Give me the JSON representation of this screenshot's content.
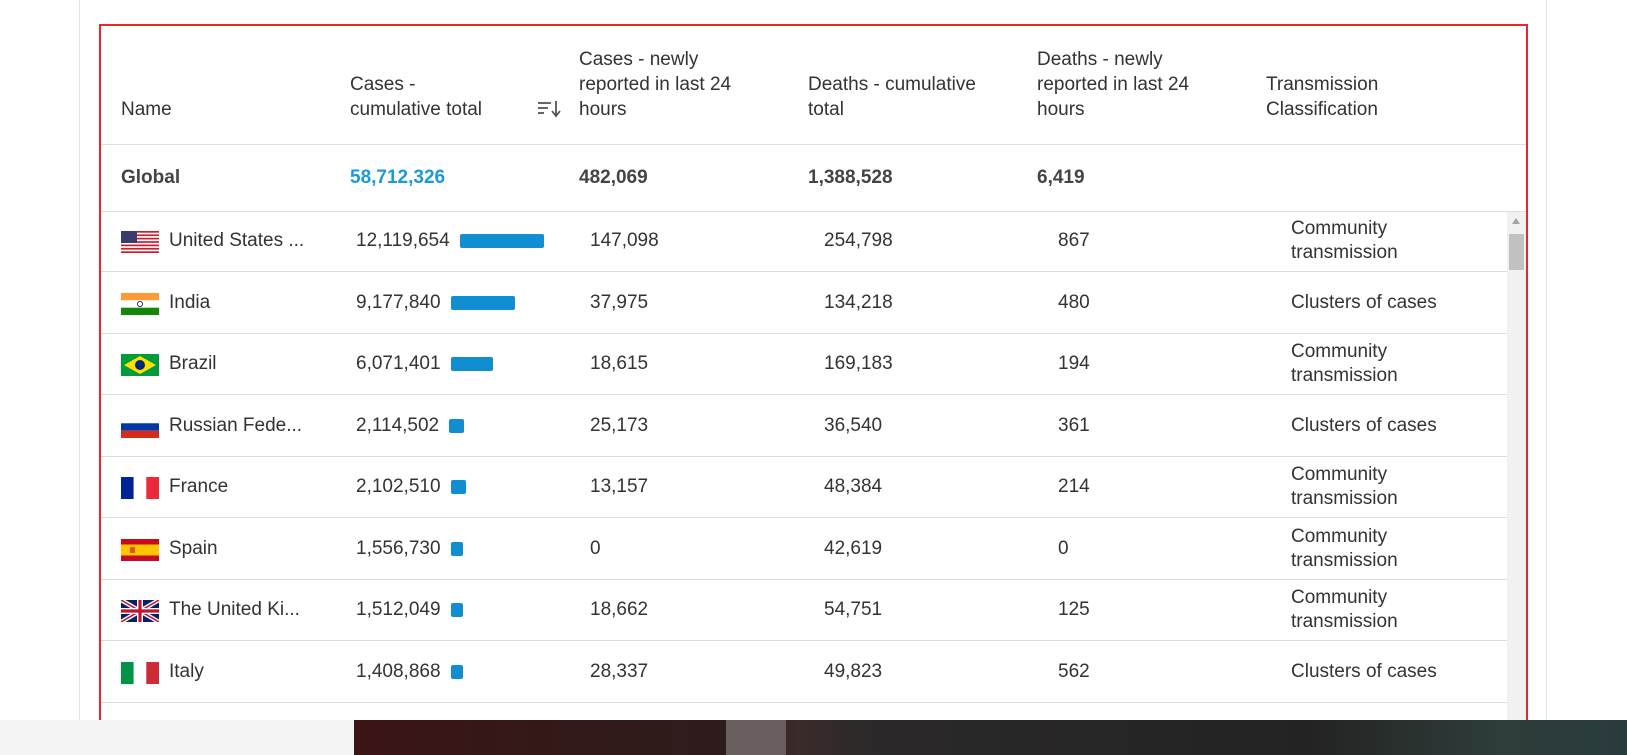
{
  "columns": {
    "name": "Name",
    "cases_total": [
      "Cases -",
      "cumulative total"
    ],
    "cases_new": [
      "Cases - newly",
      "reported in last 24",
      "hours"
    ],
    "deaths_total": [
      "Deaths - cumulative",
      "total"
    ],
    "deaths_new": [
      "Deaths - newly",
      "reported in last 24",
      "hours"
    ],
    "transmission": [
      "Transmission",
      "Classification"
    ]
  },
  "sort_icon": "sort-descending-icon",
  "global": {
    "name": "Global",
    "cases_total": "58,712,326",
    "cases_new": "482,069",
    "deaths_total": "1,388,528",
    "deaths_new": "6,419"
  },
  "rows": [
    {
      "flag": "us-flag-icon",
      "name": "United States ...",
      "cases_total": "12,119,654",
      "bar_fraction": 1.0,
      "cases_new": "147,098",
      "deaths_total": "254,798",
      "deaths_new": "867",
      "transmission": [
        "Community",
        "transmission"
      ]
    },
    {
      "flag": "india-flag-icon",
      "name": "India",
      "cases_total": "9,177,840",
      "bar_fraction": 0.757,
      "cases_new": "37,975",
      "deaths_total": "134,218",
      "deaths_new": "480",
      "transmission": [
        "Clusters of cases"
      ]
    },
    {
      "flag": "brazil-flag-icon",
      "name": "Brazil",
      "cases_total": "6,071,401",
      "bar_fraction": 0.501,
      "cases_new": "18,615",
      "deaths_total": "169,183",
      "deaths_new": "194",
      "transmission": [
        "Community",
        "transmission"
      ]
    },
    {
      "flag": "russia-flag-icon",
      "name": "Russian Fede...",
      "cases_total": "2,114,502",
      "bar_fraction": 0.174,
      "cases_new": "25,173",
      "deaths_total": "36,540",
      "deaths_new": "361",
      "transmission": [
        "Clusters of cases"
      ]
    },
    {
      "flag": "france-flag-icon",
      "name": "France",
      "cases_total": "2,102,510",
      "bar_fraction": 0.173,
      "cases_new": "13,157",
      "deaths_total": "48,384",
      "deaths_new": "214",
      "transmission": [
        "Community",
        "transmission"
      ]
    },
    {
      "flag": "spain-flag-icon",
      "name": "Spain",
      "cases_total": "1,556,730",
      "bar_fraction": 0.128,
      "cases_new": "0",
      "deaths_total": "42,619",
      "deaths_new": "0",
      "transmission": [
        "Community",
        "transmission"
      ]
    },
    {
      "flag": "uk-flag-icon",
      "name": "The United Ki...",
      "cases_total": "1,512,049",
      "bar_fraction": 0.125,
      "cases_new": "18,662",
      "deaths_total": "54,751",
      "deaths_new": "125",
      "transmission": [
        "Community",
        "transmission"
      ]
    },
    {
      "flag": "italy-flag-icon",
      "name": "Italy",
      "cases_total": "1,408,868",
      "bar_fraction": 0.116,
      "cases_new": "28,337",
      "deaths_total": "49,823",
      "deaths_new": "562",
      "transmission": [
        "Clusters of cases"
      ]
    }
  ],
  "colors": {
    "accent": "#1a9ad8",
    "bar": "#118dd1",
    "highlight_border": "#e8262c"
  }
}
